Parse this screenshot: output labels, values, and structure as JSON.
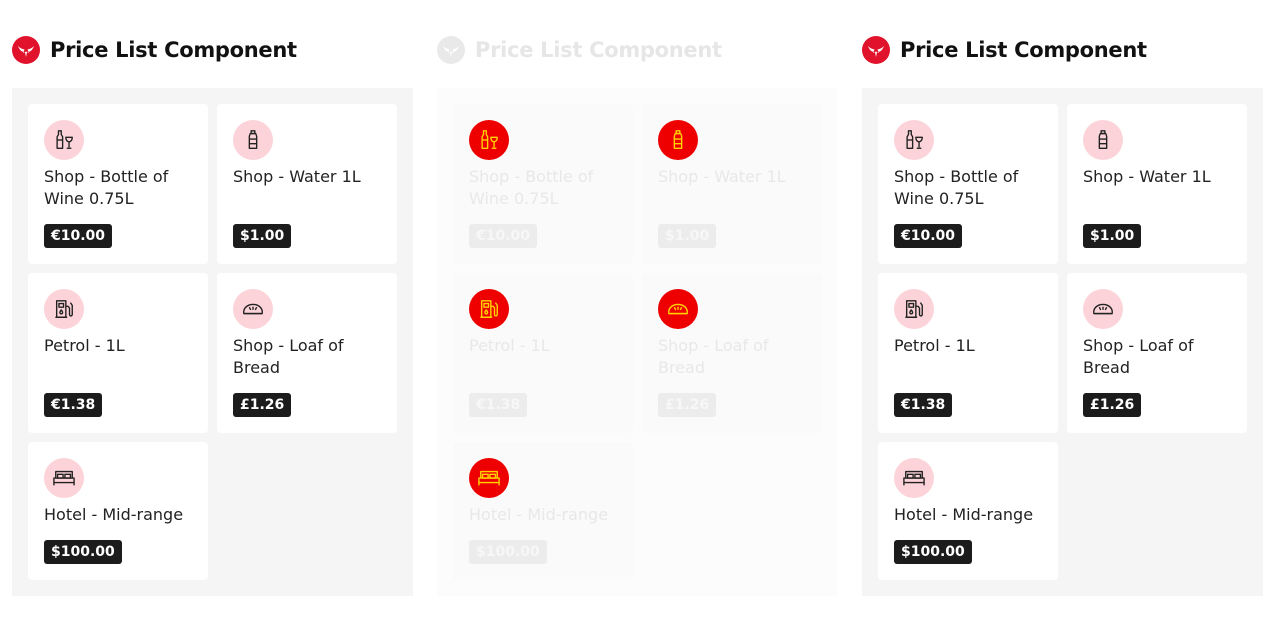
{
  "panels": [
    {
      "title": "Price List Component",
      "variant": "normal",
      "items": [
        {
          "name": "Shop - Bottle of Wine 0.75L",
          "price": "€10.00",
          "icon": "wine-bottle-glass-icon"
        },
        {
          "name": "Shop - Water 1L",
          "price": "$1.00",
          "icon": "water-bottle-icon"
        },
        {
          "name": "Petrol - 1L",
          "price": "€1.38",
          "icon": "fuel-pump-icon"
        },
        {
          "name": "Shop - Loaf of Bread",
          "price": "£1.26",
          "icon": "bread-loaf-icon"
        },
        {
          "name": "Hotel - Mid-range",
          "price": "$100.00",
          "icon": "hotel-bed-icon"
        }
      ]
    },
    {
      "title": "Price List Component",
      "variant": "faded",
      "items": [
        {
          "name": "Shop - Bottle of Wine 0.75L",
          "price": "€10.00",
          "icon": "wine-bottle-glass-icon"
        },
        {
          "name": "Shop - Water 1L",
          "price": "$1.00",
          "icon": "water-bottle-icon"
        },
        {
          "name": "Petrol - 1L",
          "price": "€1.38",
          "icon": "fuel-pump-icon"
        },
        {
          "name": "Shop - Loaf of Bread",
          "price": "£1.26",
          "icon": "bread-loaf-icon"
        },
        {
          "name": "Hotel - Mid-range",
          "price": "$100.00",
          "icon": "hotel-bed-icon"
        }
      ]
    },
    {
      "title": "Price List Component",
      "variant": "normal",
      "items": [
        {
          "name": "Shop - Bottle of Wine 0.75L",
          "price": "€10.00",
          "icon": "wine-bottle-glass-icon"
        },
        {
          "name": "Shop - Water 1L",
          "price": "$1.00",
          "icon": "water-bottle-icon"
        },
        {
          "name": "Petrol - 1L",
          "price": "€1.38",
          "icon": "fuel-pump-icon"
        },
        {
          "name": "Shop - Loaf of Bread",
          "price": "£1.26",
          "icon": "bread-loaf-icon"
        },
        {
          "name": "Hotel - Mid-range",
          "price": "$100.00",
          "icon": "hotel-bed-icon"
        }
      ]
    }
  ],
  "colors": {
    "brand_red": "#e1122c",
    "icon_bg_pink": "#fbd3d8",
    "price_badge_bg": "#1c1c1c",
    "panel_bg": "#f5f5f5",
    "faded_icon_bg": "#ee0000",
    "faded_icon_stroke": "#ffd400"
  }
}
